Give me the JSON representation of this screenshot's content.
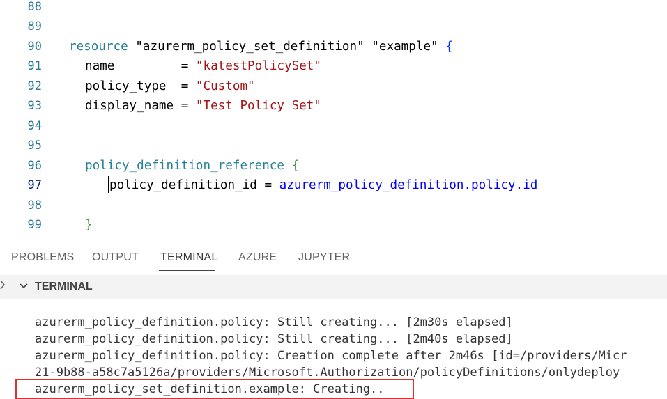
{
  "editor": {
    "lines": [
      {
        "num": "88"
      },
      {
        "num": "89"
      },
      {
        "num": "90",
        "kw": "resource",
        "s1": "\"azurerm_policy_set_definition\"",
        "s2": "\"example\"",
        "brace": "{"
      },
      {
        "num": "91",
        "key": "name",
        "pad": "         = ",
        "val": "\"katestPolicySet\""
      },
      {
        "num": "92",
        "key": "policy_type",
        "pad": "  = ",
        "val": "\"Custom\""
      },
      {
        "num": "93",
        "key": "display_name",
        "pad": " = ",
        "val": "\"Test Policy Set\""
      },
      {
        "num": "94"
      },
      {
        "num": "95"
      },
      {
        "num": "96",
        "block": "policy_definition_reference",
        "brace": "{"
      },
      {
        "num": "97",
        "key": "policy_definition_id",
        "pad": " = ",
        "ref": "azurerm_policy_definition.policy.id"
      },
      {
        "num": "98"
      },
      {
        "num": "99",
        "close": "}"
      }
    ]
  },
  "panel": {
    "tabs": [
      "PROBLEMS",
      "OUTPUT",
      "TERMINAL",
      "AZURE",
      "JUPYTER"
    ],
    "active_tab": "TERMINAL",
    "section_title": "TERMINAL",
    "terminal_lines": [
      "azurerm_policy_definition.policy: Still creating... [2m30s elapsed]",
      "azurerm_policy_definition.policy: Still creating... [2m40s elapsed]",
      "azurerm_policy_definition.policy: Creation complete after 2m46s [id=/providers/Micr",
      "21-9b88-a58c7a5126a/providers/Microsoft.Authorization/policyDefinitions/onlydeploy",
      "azurerm_policy_set_definition.example: Creating.."
    ]
  },
  "colors": {
    "highlight_box": "#e0322c",
    "line_number": "#237893",
    "string": "#a31515",
    "resource_keyword": "#267f99"
  }
}
